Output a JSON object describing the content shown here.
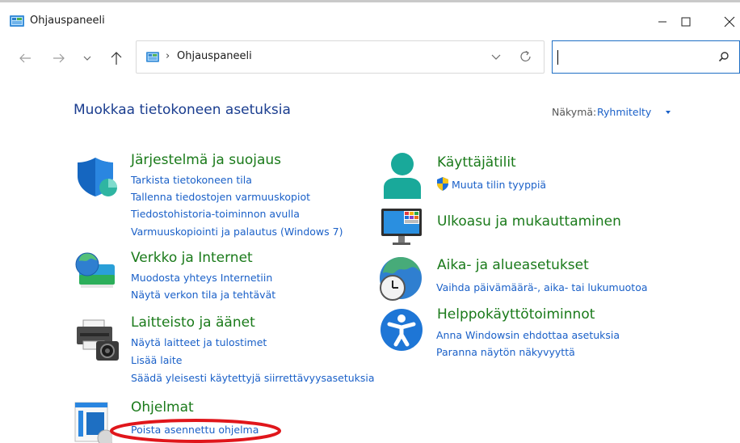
{
  "window": {
    "title": "Ohjauspaneeli",
    "controls": {
      "minimize": "—",
      "maximize": "☐",
      "close": "✕"
    }
  },
  "address": {
    "separator": "›",
    "path": "Ohjauspaneeli",
    "search_value": ""
  },
  "header": {
    "title": "Muokkaa tietokoneen asetuksia",
    "view_label": "Näkymä:",
    "view_value": "Ryhmitelty"
  },
  "categories": [
    {
      "title": "Järjestelmä ja suojaus",
      "icon": "shield-icon",
      "links": [
        "Tarkista tietokoneen tila",
        "Tallenna tiedostojen varmuuskopiot",
        "Tiedostohistoria-toiminnon avulla",
        "Varmuuskopiointi ja palautus (Windows 7)"
      ]
    },
    {
      "title": "Verkko ja Internet",
      "icon": "network-globe-icon",
      "links": [
        "Muodosta yhteys Internetiin",
        "Näytä verkon tila ja tehtävät"
      ]
    },
    {
      "title": "Laitteisto ja äänet",
      "icon": "printer-camera-icon",
      "links": [
        "Näytä laitteet ja tulostimet",
        "Lisää laite",
        "Säädä yleisesti käytettyjä siirrettävyysasetuksia"
      ]
    },
    {
      "title": "Ohjelmat",
      "icon": "programs-icon",
      "links": [
        "Poista asennettu ohjelma"
      ]
    },
    {
      "title": "Käyttäjätilit",
      "icon": "user-accounts-icon",
      "links": [
        "Muuta tilin tyyppiä"
      ]
    },
    {
      "title": "Ulkoasu ja mukauttaminen",
      "icon": "monitor-appearance-icon",
      "links": []
    },
    {
      "title": "Aika- ja alueasetukset",
      "icon": "clock-globe-icon",
      "links": [
        "Vaihda päivämäärä-, aika- tai lukumuotoa"
      ]
    },
    {
      "title": "Helppokäyttötoiminnot",
      "icon": "accessibility-icon",
      "links": [
        "Anna Windowsin ehdottaa asetuksia",
        "Paranna näytön näkyvyyttä"
      ]
    }
  ],
  "colors": {
    "category_title": "#1a7a1a",
    "link": "#1a60c8",
    "page_title": "#1a3d8f",
    "highlight_ellipse": "#e0161b"
  }
}
